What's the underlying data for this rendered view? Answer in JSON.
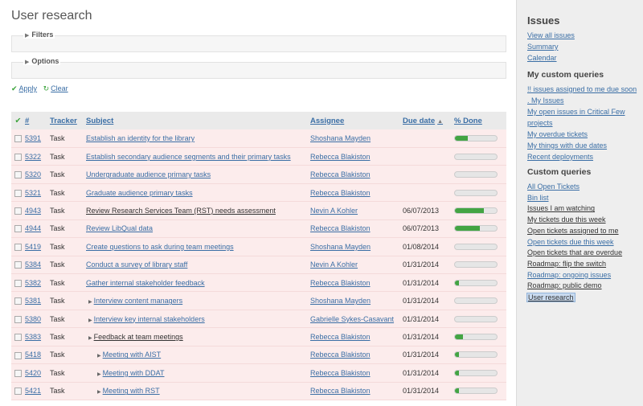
{
  "page": {
    "title": "User research",
    "filters_label": "Filters",
    "options_label": "Options",
    "apply_label": "Apply",
    "clear_label": "Clear"
  },
  "table": {
    "columns": {
      "id": "#",
      "tracker": "Tracker",
      "subject": "Subject",
      "assignee": "Assignee",
      "due": "Due date",
      "done": "% Done"
    },
    "colors": {
      "row_bg": "#fcecec",
      "progress": "#43a443",
      "header_bg": "#eaeaea"
    },
    "rows": [
      {
        "id": "5391",
        "tracker": "Task",
        "subject": "Establish an identity for the library",
        "assignee": "Shoshana Mayden",
        "due": "",
        "done": 30,
        "indent": 0,
        "triangle": false,
        "dark": false
      },
      {
        "id": "5322",
        "tracker": "Task",
        "subject": "Establish secondary audience segments and their primary tasks",
        "assignee": "Rebecca Blakiston",
        "due": "",
        "done": 0,
        "indent": 0,
        "triangle": false,
        "dark": false
      },
      {
        "id": "5320",
        "tracker": "Task",
        "subject": "Undergraduate audience primary tasks",
        "assignee": "Rebecca Blakiston",
        "due": "",
        "done": 0,
        "indent": 0,
        "triangle": false,
        "dark": false
      },
      {
        "id": "5321",
        "tracker": "Task",
        "subject": "Graduate audience primary tasks",
        "assignee": "Rebecca Blakiston",
        "due": "",
        "done": 0,
        "indent": 0,
        "triangle": false,
        "dark": false
      },
      {
        "id": "4943",
        "tracker": "Task",
        "subject": "Review Research Services Team (RST) needs assessment",
        "assignee": "Nevin A Kohler",
        "due": "06/07/2013",
        "done": 70,
        "indent": 0,
        "triangle": false,
        "dark": true
      },
      {
        "id": "4944",
        "tracker": "Task",
        "subject": "Review LibQual data",
        "assignee": "Rebecca Blakiston",
        "due": "06/07/2013",
        "done": 60,
        "indent": 0,
        "triangle": false,
        "dark": false
      },
      {
        "id": "5419",
        "tracker": "Task",
        "subject": "Create questions to ask during team meetings",
        "assignee": "Shoshana Mayden",
        "due": "01/08/2014",
        "done": 0,
        "indent": 0,
        "triangle": false,
        "dark": false
      },
      {
        "id": "5384",
        "tracker": "Task",
        "subject": "Conduct a survey of library staff",
        "assignee": "Nevin A Kohler",
        "due": "01/31/2014",
        "done": 0,
        "indent": 0,
        "triangle": false,
        "dark": false
      },
      {
        "id": "5382",
        "tracker": "Task",
        "subject": "Gather internal stakeholder feedback",
        "assignee": "Rebecca Blakiston",
        "due": "01/31/2014",
        "done": 10,
        "indent": 0,
        "triangle": false,
        "dark": false
      },
      {
        "id": "5381",
        "tracker": "Task",
        "subject": "Interview content managers",
        "assignee": "Shoshana Mayden",
        "due": "01/31/2014",
        "done": 0,
        "indent": 1,
        "triangle": true,
        "dark": false
      },
      {
        "id": "5380",
        "tracker": "Task",
        "subject": "Interview key internal stakeholders",
        "assignee": "Gabrielle Sykes-Casavant",
        "due": "01/31/2014",
        "done": 0,
        "indent": 1,
        "triangle": true,
        "dark": false
      },
      {
        "id": "5383",
        "tracker": "Task",
        "subject": "Feedback at team meetings",
        "assignee": "Rebecca Blakiston",
        "due": "01/31/2014",
        "done": 20,
        "indent": 1,
        "triangle": true,
        "dark": true
      },
      {
        "id": "5418",
        "tracker": "Task",
        "subject": "Meeting with AIST",
        "assignee": "Rebecca Blakiston",
        "due": "01/31/2014",
        "done": 10,
        "indent": 2,
        "triangle": true,
        "dark": false
      },
      {
        "id": "5420",
        "tracker": "Task",
        "subject": "Meeting with DDAT",
        "assignee": "Rebecca Blakiston",
        "due": "01/31/2014",
        "done": 10,
        "indent": 2,
        "triangle": true,
        "dark": false
      },
      {
        "id": "5421",
        "tracker": "Task",
        "subject": "Meeting with RST",
        "assignee": "Rebecca Blakiston",
        "due": "01/31/2014",
        "done": 10,
        "indent": 2,
        "triangle": true,
        "dark": false
      }
    ]
  },
  "sidebar": {
    "issues_title": "Issues",
    "issues_links": [
      "View all issues",
      "Summary",
      "Calendar"
    ],
    "my_queries_title": "My custom queries",
    "my_queries": [
      "!! issues assigned to me due soon",
      ". My Issues",
      "My open issues in Critical Few",
      "projects",
      "My overdue tickets",
      "My things with due dates",
      "Recent deployments"
    ],
    "custom_queries_title": "Custom queries",
    "custom_queries": [
      {
        "label": "All Open Tickets",
        "style": "blue"
      },
      {
        "label": "Bin list",
        "style": "blue"
      },
      {
        "label": "Issues I am watching",
        "style": "dark"
      },
      {
        "label": "My tickets due this week",
        "style": "dark"
      },
      {
        "label": "Open tickets assigned to me",
        "style": "dark"
      },
      {
        "label": "Open tickets due this week",
        "style": "blue"
      },
      {
        "label": "Open tickets that are overdue",
        "style": "dark"
      },
      {
        "label": "Roadmap: flip the switch",
        "style": "dark"
      },
      {
        "label": "Roadmap: ongoing issues",
        "style": "blue"
      },
      {
        "label": "Roadmap: public demo",
        "style": "dark"
      },
      {
        "label": "User research",
        "style": "selected"
      }
    ]
  }
}
